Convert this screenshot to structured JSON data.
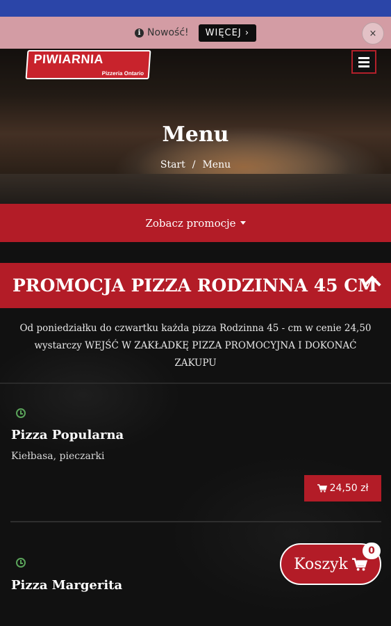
{
  "notice": {
    "info_label": "Nowość!",
    "more_button": "WIĘCEJ ›",
    "close_label": "×"
  },
  "brand": {
    "logo_main": "PIWIARNIA",
    "logo_sub": "Pizzeria Ontario"
  },
  "hero": {
    "title": "Menu",
    "breadcrumb": [
      "Start",
      "/",
      "Menu"
    ]
  },
  "promo_toggle": {
    "label": "Zobacz promocje"
  },
  "promo_banner": {
    "title": "PROMOCJA PIZZA RODZINNA 45 CM",
    "description": "Od poniedziałku do czwartku każda pizza Rodzinna 45 - cm w cenie 24,50 wystarczy WEJŚĆ W ZAKŁADKĘ PIZZA PROMOCYJNA I DOKONAĆ ZAKUPU"
  },
  "items": [
    {
      "name": "Pizza Popularna",
      "description": "Kiełbasa, pieczarki",
      "price": "24,50 zł"
    },
    {
      "name": "Pizza Margerita",
      "description": "",
      "price": ""
    }
  ],
  "cart": {
    "label": "Koszyk",
    "count": "0"
  },
  "colors": {
    "brand_red": "#b31c27",
    "top_bar_blue": "#2b45a8",
    "notice_pink": "#d39ca4",
    "clock_green": "#5aa35a"
  },
  "icons": [
    "info-icon",
    "close-icon",
    "menu-icon",
    "caret-down-icon",
    "chevron-up-icon",
    "clock-icon",
    "cart-icon"
  ]
}
